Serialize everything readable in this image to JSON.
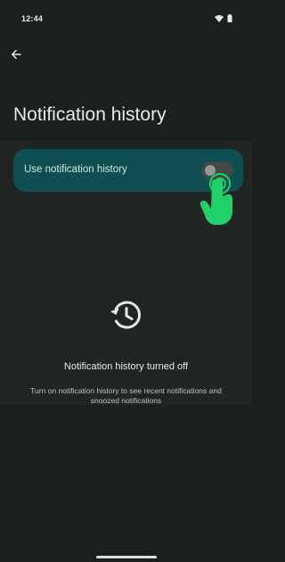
{
  "status_bar": {
    "time": "12:44",
    "icons": [
      "wifi-icon",
      "battery-icon"
    ]
  },
  "header": {
    "back_icon": "arrow-left-icon",
    "title": "Notification history"
  },
  "toggle": {
    "label": "Use notification history",
    "checked": false
  },
  "empty_state": {
    "icon": "history-icon",
    "title": "Notification history turned off",
    "description": "Turn on notification history to see recent notifications and snoozed notifications"
  },
  "colors": {
    "background": "#1b1f1e",
    "card": "#0f4f51",
    "tap_indicator": "#22d06a"
  }
}
